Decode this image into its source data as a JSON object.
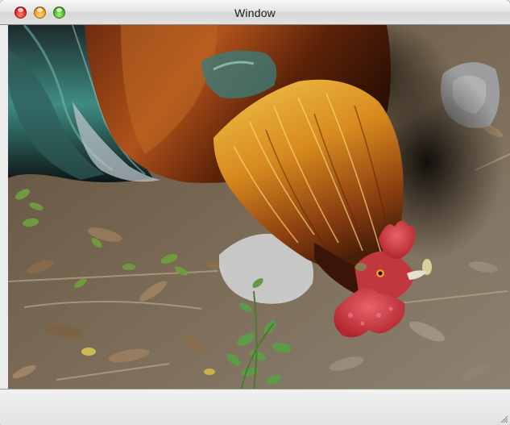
{
  "window": {
    "title": "Window"
  },
  "titlebar": {
    "buttons": [
      {
        "name": "close",
        "color": "#e0291e"
      },
      {
        "name": "minimize",
        "color": "#f0a21a"
      },
      {
        "name": "zoom",
        "color": "#4cb825"
      }
    ]
  },
  "content": {
    "image_subject": "rooster"
  },
  "colors": {
    "titlebar": "#e2e2e2",
    "window_background": "#ececec"
  }
}
